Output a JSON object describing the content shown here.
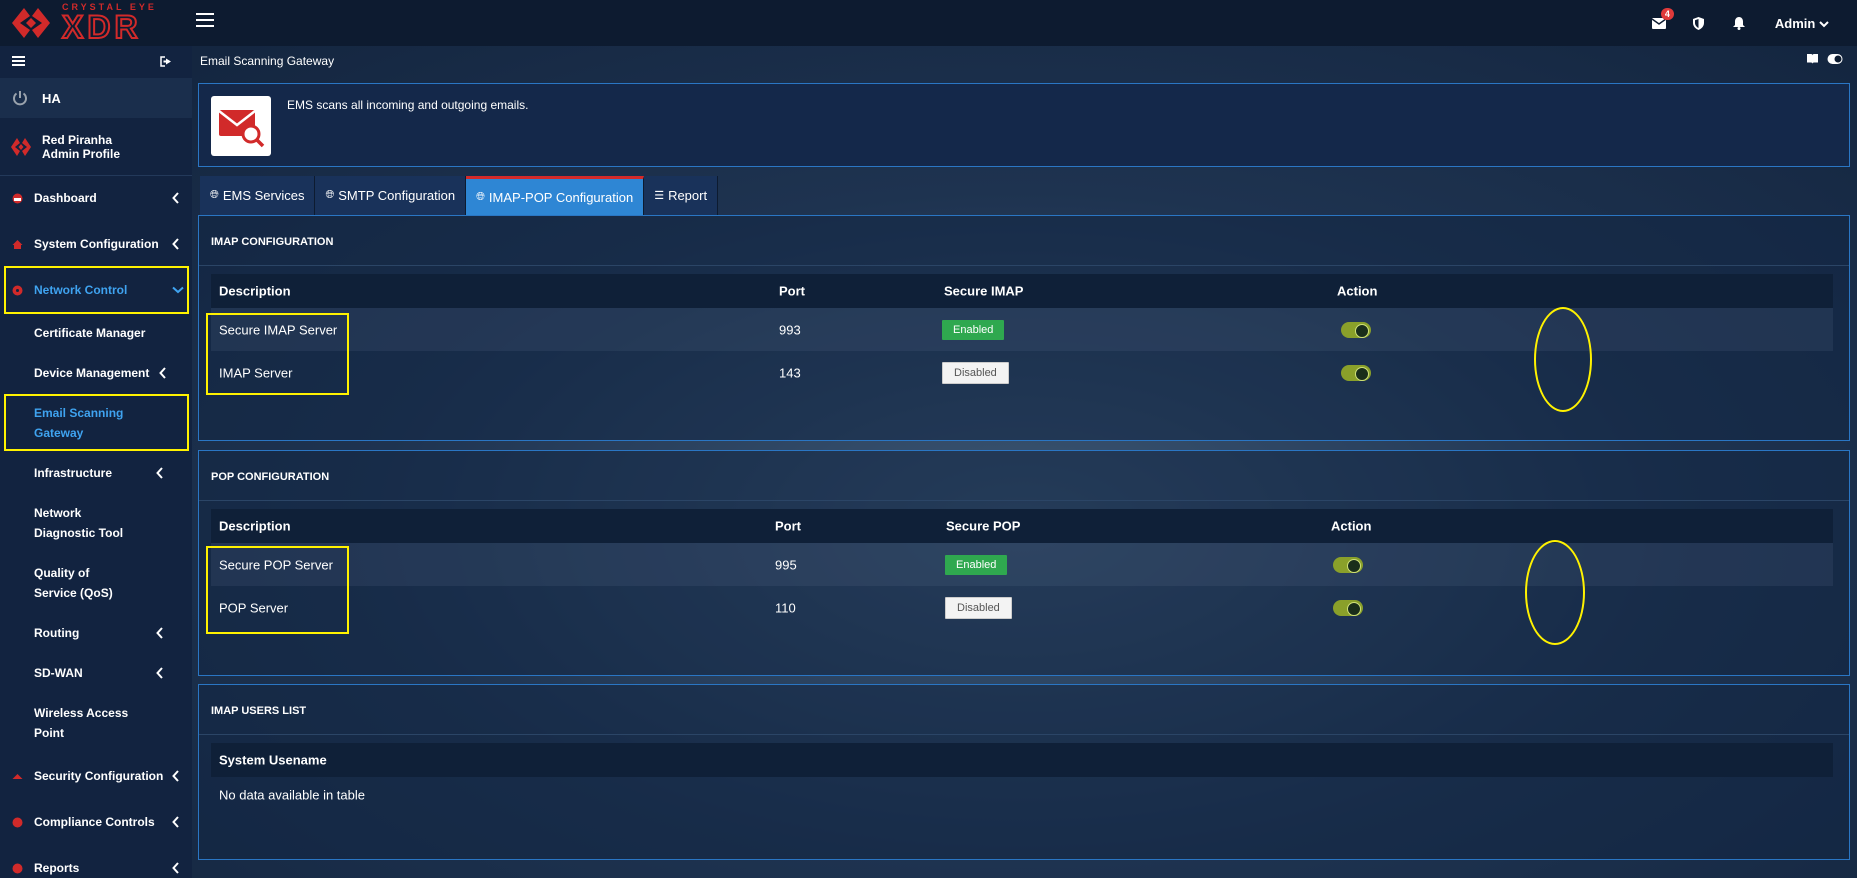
{
  "brand": {
    "sub": "CRYSTAL EYE",
    "main": "XDR"
  },
  "topbar": {
    "mail_badge": "4",
    "user": "Admin"
  },
  "sidebar": {
    "ha_label": "HA",
    "profile": {
      "name": "Red Piranha",
      "role": "Admin Profile"
    },
    "items": [
      {
        "label": "Dashboard"
      },
      {
        "label": "System Configuration"
      },
      {
        "label": "Network Control"
      },
      {
        "label": "Security Configuration"
      },
      {
        "label": "Compliance Controls"
      },
      {
        "label": "Reports"
      }
    ],
    "subitems": [
      {
        "label": "Certificate Manager"
      },
      {
        "label": "Device Management"
      },
      {
        "label": "Email Scanning Gateway"
      },
      {
        "label": "Infrastructure"
      },
      {
        "label": "Network Diagnostic Tool"
      },
      {
        "label": "Quality of Service (QoS)"
      },
      {
        "label": "Routing"
      },
      {
        "label": "SD-WAN"
      },
      {
        "label": "Wireless Access Point"
      }
    ]
  },
  "page": {
    "title": "Email Scanning Gateway",
    "info": "EMS scans all incoming and outgoing emails."
  },
  "tabs": [
    {
      "label": "EMS Services"
    },
    {
      "label": "SMTP Configuration"
    },
    {
      "label": "IMAP-POP Configuration"
    },
    {
      "label": "Report"
    }
  ],
  "imap": {
    "title": "IMAP CONFIGURATION",
    "headers": {
      "description": "Description",
      "port": "Port",
      "secure": "Secure IMAP",
      "action": "Action"
    },
    "rows": [
      {
        "description": "Secure IMAP Server",
        "port": "993",
        "status": "Enabled"
      },
      {
        "description": "IMAP Server",
        "port": "143",
        "status": "Disabled"
      }
    ]
  },
  "pop": {
    "title": "POP CONFIGURATION",
    "headers": {
      "description": "Description",
      "port": "Port",
      "secure": "Secure POP",
      "action": "Action"
    },
    "rows": [
      {
        "description": "Secure POP Server",
        "port": "995",
        "status": "Enabled"
      },
      {
        "description": "POP Server",
        "port": "110",
        "status": "Disabled"
      }
    ]
  },
  "users": {
    "title": "IMAP USERS LIST",
    "header": "System Usename",
    "empty": "No data available in table"
  },
  "colors": {
    "accent": "#2e86d4",
    "brand_red": "#d12a2a",
    "highlight": "#fff200",
    "enabled": "#2fa84f",
    "toggle_on": "#8aa02a"
  }
}
